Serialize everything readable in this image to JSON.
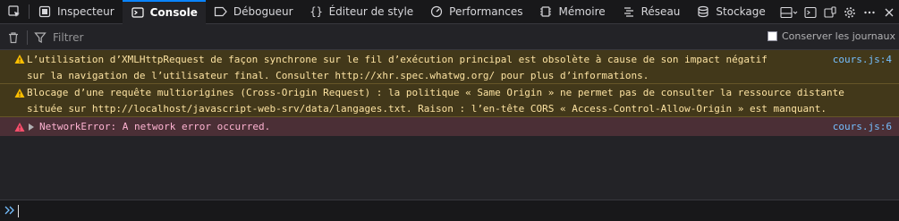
{
  "toolbar": {
    "tabs": [
      {
        "label": "Inspecteur",
        "icon": "inspector-icon"
      },
      {
        "label": "Console",
        "icon": "console-icon",
        "selected": true
      },
      {
        "label": "Débogueur",
        "icon": "debugger-icon"
      },
      {
        "label": "Éditeur de style",
        "icon": "style-editor-icon"
      },
      {
        "label": "Performances",
        "icon": "performance-icon"
      },
      {
        "label": "Mémoire",
        "icon": "memory-icon"
      },
      {
        "label": "Réseau",
        "icon": "network-icon"
      },
      {
        "label": "Stockage",
        "icon": "storage-icon"
      }
    ]
  },
  "filterbar": {
    "placeholder": "Filtrer",
    "persist_label": "Conserver les journaux"
  },
  "messages": [
    {
      "level": "warning",
      "text": "L’utilisation d’XMLHttpRequest de façon synchrone sur le fil d’exécution principal est obsolète à cause de son impact négatif\nsur la navigation de l’utilisateur final. Consulter http://xhr.spec.whatwg.org/ pour plus d’informations.",
      "location": "cours.js:4"
    },
    {
      "level": "warning",
      "text": "Blocage d’une requête multiorigines (Cross-Origin Request) : la politique « Same Origin » ne permet pas de consulter la ressource distante\nsituée sur http://localhost/javascript-web-srv/data/langages.txt. Raison : l’en-tête CORS « Access-Control-Allow-Origin » est manquant.",
      "location": ""
    },
    {
      "level": "error",
      "text": "NetworkError: A network error occurred.",
      "location": "cours.js:6"
    }
  ],
  "colors": {
    "toolbar_bg": "#18181a",
    "panel_bg": "#232327",
    "warning_bg": "#42381a",
    "warning_text": "#fce2a1",
    "error_bg": "#4b2f36",
    "error_text": "#ffb3d2",
    "link": "#75bfff",
    "accent": "#0a84ff"
  }
}
